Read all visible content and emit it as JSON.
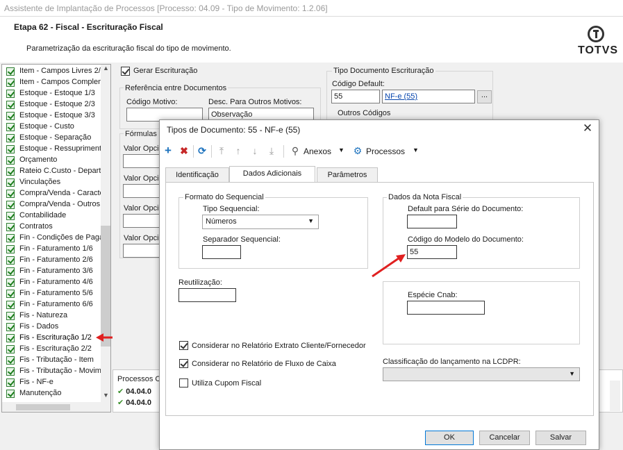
{
  "window": {
    "title": "Assistente de Implantação de Processos [Processo: 04.09 - Tipo de Movimento: 1.2.06]"
  },
  "header": {
    "step_title": "Etapa 62 - Fiscal - Escrituração Fiscal",
    "step_desc": "Parametrização da escrituração fiscal do tipo de movimento.",
    "logo_text": "TOTVS"
  },
  "tree": {
    "items": [
      {
        "label": "Item - Campos Livres 2/"
      },
      {
        "label": "Item - Campos Complem"
      },
      {
        "label": "Estoque - Estoque 1/3"
      },
      {
        "label": "Estoque - Estoque 2/3"
      },
      {
        "label": "Estoque - Estoque 3/3"
      },
      {
        "label": "Estoque - Custo"
      },
      {
        "label": "Estoque - Separação"
      },
      {
        "label": "Estoque - Ressupriment"
      },
      {
        "label": "Orçamento"
      },
      {
        "label": "Rateio C.Custo - Depart"
      },
      {
        "label": "Vinculações"
      },
      {
        "label": "Compra/Venda - Caracte"
      },
      {
        "label": "Compra/Venda - Outros"
      },
      {
        "label": "Contabilidade"
      },
      {
        "label": "Contratos"
      },
      {
        "label": "Fin - Condições de Paga"
      },
      {
        "label": "Fin - Faturamento 1/6"
      },
      {
        "label": "Fin - Faturamento 2/6"
      },
      {
        "label": "Fin - Faturamento 3/6"
      },
      {
        "label": "Fin - Faturamento 4/6"
      },
      {
        "label": "Fin - Faturamento 5/6"
      },
      {
        "label": "Fin - Faturamento 6/6"
      },
      {
        "label": "Fis - Natureza"
      },
      {
        "label": "Fis - Dados"
      },
      {
        "label": "Fis - Escrituração 1/2"
      },
      {
        "label": "Fis - Escrituração 2/2"
      },
      {
        "label": "Fis - Tributação - Item"
      },
      {
        "label": "Fis - Tributação - Movim"
      },
      {
        "label": "Fis - NF-e"
      },
      {
        "label": "Manutenção"
      }
    ]
  },
  "form": {
    "gerar_escrituracao": "Gerar Escrituração",
    "referencia_title": "Referência entre Documentos",
    "codigo_motivo_label": "Código Motivo:",
    "desc_outros_label": "Desc. Para Outros Motivos:",
    "desc_outros_value": "Observação",
    "formulas_title": "Fórmulas C",
    "valor_opcio_label": "Valor Opcio",
    "tipo_doc_title": "Tipo Documento Escrituração",
    "codigo_default_label": "Código Default:",
    "codigo_default_value": "55",
    "nfe_link": "NF-e (55)",
    "ellipsis": "...",
    "outros_codigos": "Outros Códigos",
    "processos_label": "Processos Co",
    "processos_rows": [
      "04.04.0",
      "04.04.0"
    ]
  },
  "dialog": {
    "title": "Tipos de Documento: 55 - NF-e (55)",
    "toolbar": {
      "anexos": "Anexos",
      "processos": "Processos"
    },
    "tabs": [
      "Identificação",
      "Dados Adicionais",
      "Parâmetros"
    ],
    "formato_title": "Formato do Sequencial",
    "tipo_seq_label": "Tipo Sequencial:",
    "tipo_seq_value": "Números",
    "separador_label": "Separador Sequencial:",
    "separador_value": "",
    "reutilizacao_label": "Reutilização:",
    "reutilizacao_value": "",
    "dados_nf_title": "Dados da Nota Fiscal",
    "default_serie_label": "Default para Série do Documento:",
    "default_serie_value": "",
    "codigo_modelo_label": "Código do Modelo do Documento:",
    "codigo_modelo_value": "55",
    "especie_label": "Espécie Cnab:",
    "especie_value": "",
    "chk_extrato": "Considerar no Relatório Extrato Cliente/Fornecedor",
    "chk_fluxo": "Considerar no Relatório de Fluxo de Caixa",
    "chk_cupom": "Utiliza Cupom Fiscal",
    "lcdpr_label": "Classificação do lançamento na LCDPR:",
    "lcdpr_value": "",
    "ok": "OK",
    "cancelar": "Cancelar",
    "salvar": "Salvar"
  },
  "colors": {
    "accent": "#0078d7",
    "arrow": "#e02020",
    "check_green": "#1b7d1b"
  }
}
